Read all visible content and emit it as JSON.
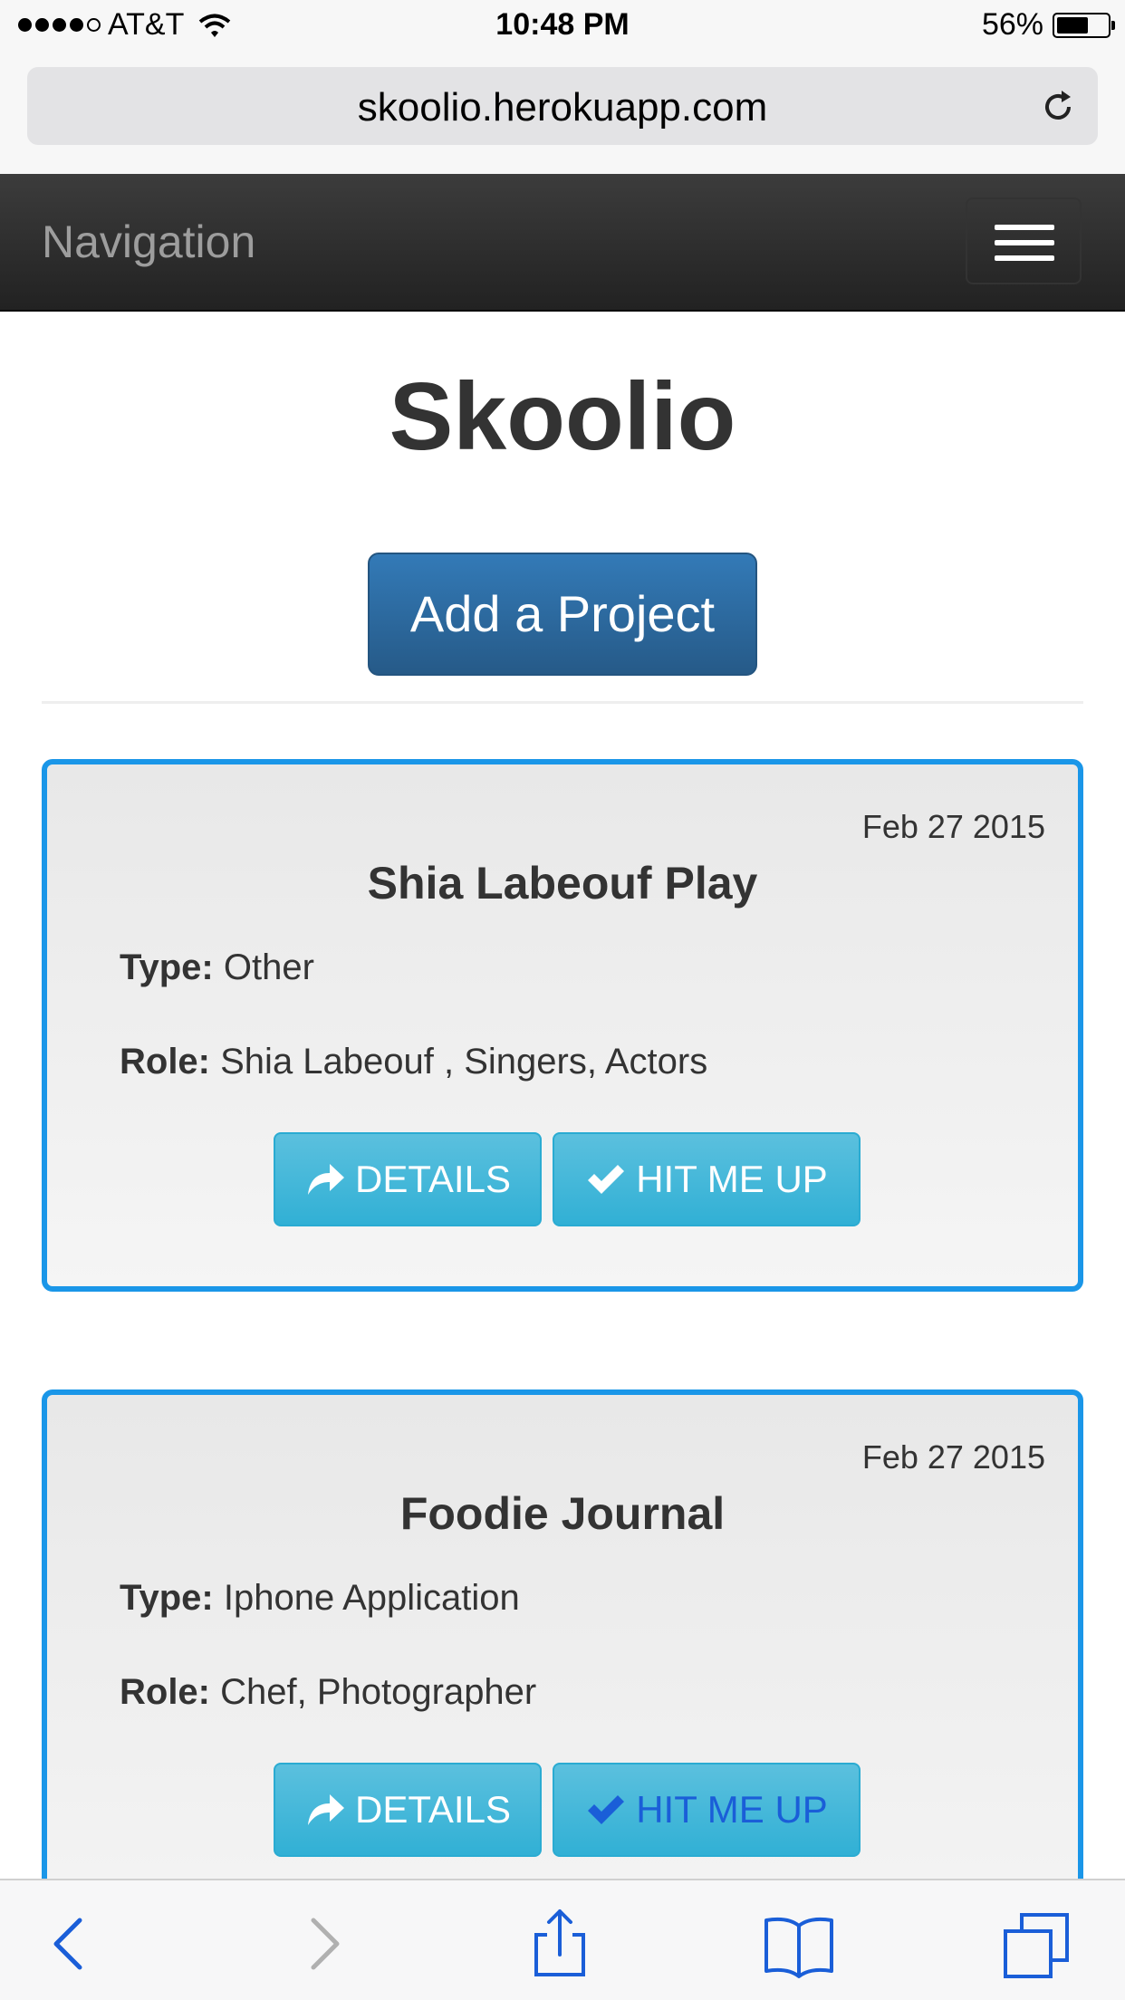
{
  "status_bar": {
    "carrier": "AT&T",
    "time": "10:48 PM",
    "battery": "56%",
    "signal_bars_filled": 4,
    "signal_bars_total": 5
  },
  "browser": {
    "url": "skoolio.herokuapp.com"
  },
  "navbar": {
    "brand": "Navigation"
  },
  "header": {
    "title": "Skoolio",
    "add_button": "Add a Project"
  },
  "projects": [
    {
      "date": "Feb 27 2015",
      "title": "Shia Labeouf Play",
      "type_label": "Type:",
      "type": "Other",
      "role_label": "Role:",
      "role": "Shia Labeouf , Singers, Actors",
      "details_label": "DETAILS",
      "hit_label": "HIT ME UP"
    },
    {
      "date": "Feb 27 2015",
      "title": "Foodie Journal",
      "type_label": "Type:",
      "type": "Iphone Application",
      "role_label": "Role:",
      "role": "Chef, Photographer",
      "details_label": "DETAILS",
      "hit_label": "HIT ME UP"
    }
  ],
  "toolbar": {
    "icons": [
      "back-icon",
      "forward-icon",
      "share-icon",
      "bookmarks-icon",
      "tabs-icon"
    ]
  },
  "colors": {
    "card_border": "#1a96e8",
    "primary_button": "#337ab7",
    "info_button": "#5bc0de",
    "navbar": "#222222",
    "ios_blue": "#1a5ed8"
  }
}
